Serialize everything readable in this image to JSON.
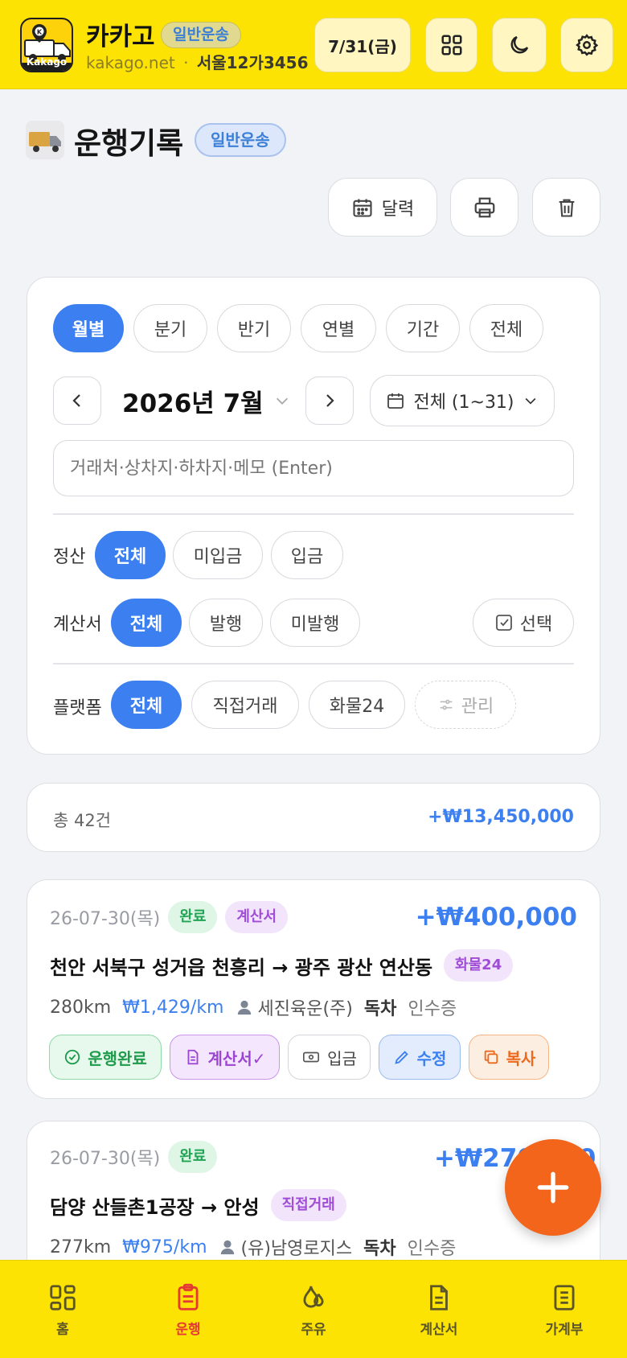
{
  "header": {
    "logo_text": "Kakago",
    "app_name": "카카고",
    "mode_badge": "일반운송",
    "domain": "kakago.net",
    "separator": "·",
    "plate": "서울12가3456",
    "date_label": "7/31(금)"
  },
  "page": {
    "title": "운행기록",
    "badge": "일반운송",
    "calendar_label": "달력"
  },
  "filters": {
    "period_tabs": [
      "월별",
      "분기",
      "반기",
      "연별",
      "기간",
      "전체"
    ],
    "month_label": "2026년 7월",
    "range_label": "전체 (1~31)",
    "search_placeholder": "거래처·상차지·하차지·메모 (Enter)",
    "settlement": {
      "label": "정산",
      "options": [
        "전체",
        "미입금",
        "입금"
      ]
    },
    "invoice": {
      "label": "계산서",
      "options": [
        "전체",
        "발행",
        "미발행"
      ],
      "select_label": "선택"
    },
    "platform": {
      "label": "플랫폼",
      "options": [
        "전체",
        "직접거래",
        "화물24"
      ],
      "manage_label": "관리"
    }
  },
  "summary": {
    "count_label": "총 42건",
    "total": "+₩13,450,000"
  },
  "trips": [
    {
      "date": "26-07-30(목)",
      "status": "완료",
      "invoice_badge": "계산서",
      "amount": "+₩400,000",
      "route": "천안 서북구 성거읍 천흥리 → 광주 광산 연산동",
      "platform": "화물24",
      "distance": "280km",
      "per_km": "₩1,429/km",
      "client": "세진육운(주)",
      "vehicle": "독차",
      "receipt": "인수증",
      "actions": [
        "운행완료",
        "계산서✓",
        "입금",
        "수정",
        "복사"
      ]
    },
    {
      "date": "26-07-30(목)",
      "status": "완료",
      "amount": "+₩270,000",
      "route": "담양 산들촌1공장 → 안성",
      "platform": "직접거래",
      "distance": "277km",
      "per_km": "₩975/km",
      "client": "(유)남영로지스",
      "vehicle": "독차",
      "receipt": "인수증"
    }
  ],
  "nav": [
    "홈",
    "운행",
    "주유",
    "계산서",
    "가계부"
  ],
  "colors": {
    "brand_yellow": "#fde303",
    "accent_blue": "#3b7ff0",
    "fab_orange": "#f2651a",
    "nav_active": "#e53935"
  }
}
